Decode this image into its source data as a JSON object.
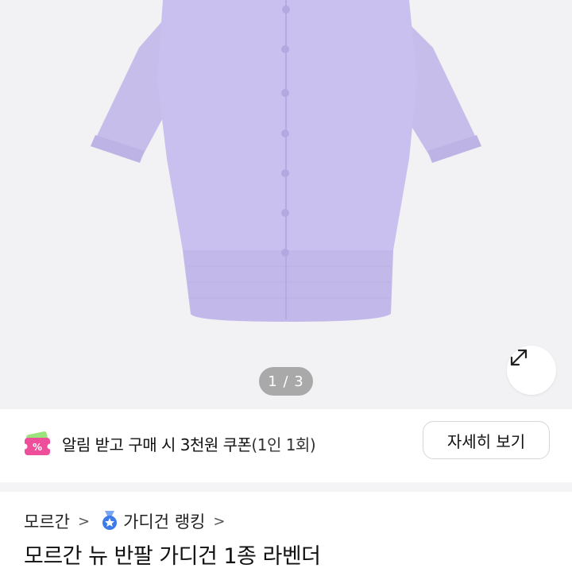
{
  "gallery": {
    "current_page": 1,
    "total_pages": 3,
    "indicator_text": "1 / 3",
    "product_color": "#c7bfea"
  },
  "coupon": {
    "text_main": "알림 받고 구매 시 3천원 쿠폰",
    "text_sub": "(1인 1회)",
    "button_label": "자세히 보기",
    "icon": "coupon-ticket-icon",
    "icon_color": "#e84d9a"
  },
  "breadcrumb": {
    "brand": "모르간",
    "ranking": "가디건 랭킹"
  },
  "product": {
    "title": "모르간 뉴 반팔 가디건 1종 라벤더"
  }
}
